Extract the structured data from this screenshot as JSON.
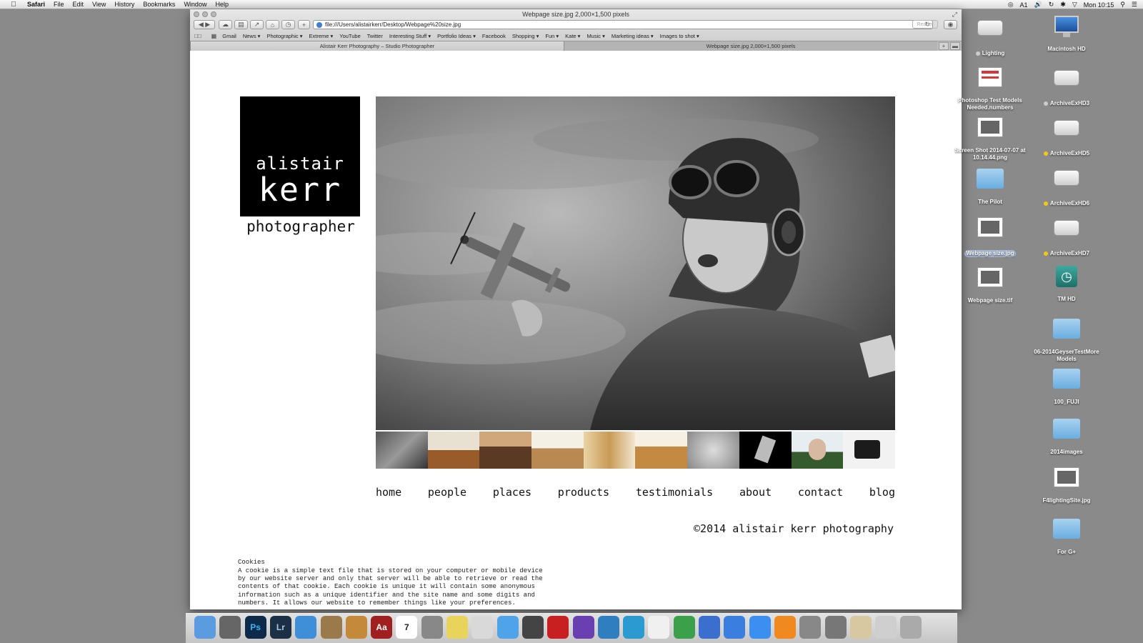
{
  "menubar": {
    "app": "Safari",
    "menus": [
      "File",
      "Edit",
      "View",
      "History",
      "Bookmarks",
      "Window",
      "Help"
    ],
    "status_items": [
      "A1",
      "Mon 10:15"
    ]
  },
  "window": {
    "title": "Webpage size.jpg 2,000×1,500 pixels",
    "url": "file:///Users/alistairkerr/Desktop/Webpage%20size.jpg",
    "reader_label": "Reader",
    "bookmarks": [
      "Gmail",
      "News ▾",
      "Photographic ▾",
      "Extreme ▾",
      "YouTube",
      "Twitter",
      "Interesting Stuff ▾",
      "Portfolio Ideas ▾",
      "Facebook",
      "Shopping ▾",
      "Fun ▾",
      "Kate ▾",
      "Music ▾",
      "Marketing ideas ▾",
      "Images to shot ▾"
    ],
    "tabs": [
      {
        "label": "Alistair Kerr Photography – Studio Photographer",
        "active": true
      },
      {
        "label": "Webpage size.jpg 2,000×1,500 pixels",
        "active": false
      }
    ]
  },
  "page": {
    "logo": {
      "first": "alistair",
      "last": "kerr",
      "tagline": "photographer"
    },
    "nav": [
      "home",
      "people",
      "places",
      "products",
      "testimonials",
      "about",
      "contact",
      "blog"
    ],
    "copyright": "©2014 alistair kerr photography",
    "cookies": {
      "title": "Cookies",
      "lines": [
        "A cookie is a simple text file that is stored on your computer or mobile device",
        "by our website server and only that server will be able to retrieve or read the",
        "contents of that cookie. Each cookie is unique it will contain some anonymous",
        "information such as a unique identifier and the site name and some digits and",
        "numbers. It allows our website to remember things like your preferences."
      ]
    }
  },
  "desktop": {
    "icons": [
      {
        "label": "Lighting",
        "dot": "#cccccc",
        "kind": "drive"
      },
      {
        "label": "Macintosh HD",
        "kind": "monitor"
      },
      {
        "label": "Photoshop Test Models Needed.numbers",
        "kind": "doc"
      },
      {
        "label": "ArchiveExHD3",
        "dot": "#cccccc",
        "kind": "drive"
      },
      {
        "label": "Screen Shot 2014-07-07 at 10.14.44.png",
        "kind": "image"
      },
      {
        "label": "ArchiveExHD5",
        "dot": "#f5c518",
        "kind": "drive"
      },
      {
        "label": "The Pilot",
        "kind": "folder"
      },
      {
        "label": "ArchiveExHD6",
        "dot": "#f5c518",
        "kind": "drive"
      },
      {
        "label": "Webpage size.jpg",
        "kind": "image",
        "selected": true
      },
      {
        "label": "ArchiveExHD7",
        "dot": "#f5c518",
        "kind": "drive"
      },
      {
        "label": "Webpage size.tif",
        "kind": "image"
      },
      {
        "label": "TM HD",
        "kind": "timemachine"
      },
      {
        "label": "06-2014GeyserTestMore Models",
        "kind": "folder"
      },
      {
        "label": "100_FUJI",
        "kind": "folder"
      },
      {
        "label": "2014images",
        "kind": "folder"
      },
      {
        "label": "F4lightingSite.jpg",
        "kind": "image"
      },
      {
        "label": "For G+",
        "kind": "folder"
      }
    ]
  },
  "dock": {
    "apps": [
      "finder-icon",
      "launchpad-icon",
      "photoshop-icon",
      "lightroom-icon",
      "safari-icon",
      "mail-icon",
      "contacts-icon",
      "dictionary-icon",
      "calendar-icon",
      "calculator-icon",
      "stickies-icon",
      "preview-icon",
      "messages-icon",
      "facetime-icon",
      "photo-booth-icon",
      "imovie-icon",
      "iphoto-icon",
      "dashcode-icon",
      "textedit-icon",
      "numbers-icon",
      "keynote-icon",
      "itunes-icon",
      "app-store-icon",
      "ibooks-icon",
      "system-preferences-icon",
      "utility-icon",
      "poker-icon",
      "documents-icon",
      "trash-icon"
    ],
    "calendar_day": "7",
    "ps_label": "Ps",
    "lr_label": "Lr",
    "dict_label": "Aa"
  }
}
